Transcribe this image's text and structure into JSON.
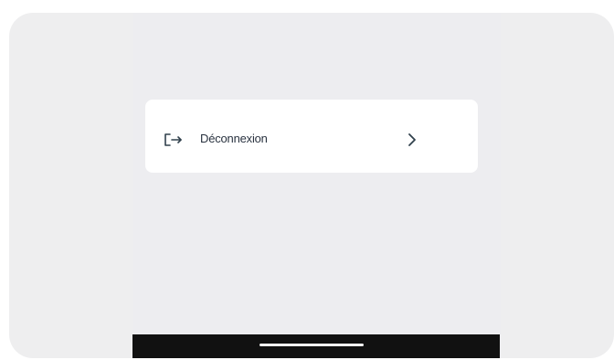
{
  "menu": {
    "items": [
      {
        "label": "Déconnexion",
        "icon": "logout-icon",
        "trailing_icon": "chevron-right-icon"
      }
    ]
  },
  "colors": {
    "frame_background": "#eeeeef",
    "screen_background": "#ededf0",
    "card_background": "#ffffff",
    "text": "#2a3340",
    "icon": "#30404c",
    "home_bar": "#111111",
    "home_indicator": "#f2f2f2"
  }
}
